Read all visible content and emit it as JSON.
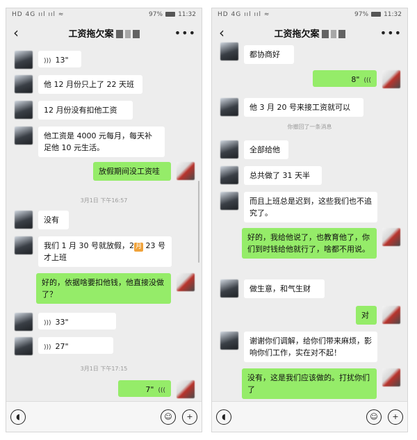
{
  "status_bar": {
    "left": "HD 4G ııl ııl ≈",
    "battery": "97%",
    "time": "11:32"
  },
  "chat_title": "工资拖欠案",
  "icons": {
    "back": "chevron-left-icon",
    "more": "more-icon",
    "voice": "voice-icon",
    "emoji": "emoji-icon",
    "plus": "plus-icon",
    "wave": "voice-wave-icon"
  },
  "colors": {
    "out_bubble": "#95ec69",
    "in_bubble": "#ffffff",
    "background": "#ededed"
  },
  "left_chat": {
    "m1": "13\"",
    "m2": "他 12 月份只上了 22 天班",
    "m3": "12 月份没有扣他工资",
    "m4": "他工资是 4000 元每月，每天补足他 10 元生活。",
    "m5": "放假期间没工资哇",
    "t1": "3月1日 下午16:57",
    "m6": "没有",
    "m7a": "我们 1 月 30 号就放假，2",
    "m7b": "月",
    "m7c": " 23 号才上班",
    "m8": "好的，依据啥要扣他钱，他直接没做了？",
    "m9": "33\"",
    "m10": "27\"",
    "t2": "3月1日 下午17:15",
    "m11": "7\""
  },
  "right_chat": {
    "m1": "都协商好",
    "m2": "8\"",
    "m3": "他 3 月 20 号来接工资就可以",
    "t1": "你撤回了一条消息",
    "m4": "全部给他",
    "m5": "总共做了 31 天半",
    "m6": "而且上班总是迟到，这些我们也不追究了。",
    "m7": "好的，我给他说了，也教育他了，你们到时钱给他就行了，啥都不用说。",
    "m8": "做生意，和气生财",
    "m9": "对",
    "m10": "谢谢你们调解，给你们带来麻烦，影响你们工作，实在对不起！",
    "m11": "没有，这是我们应该做的。打扰你们了"
  }
}
